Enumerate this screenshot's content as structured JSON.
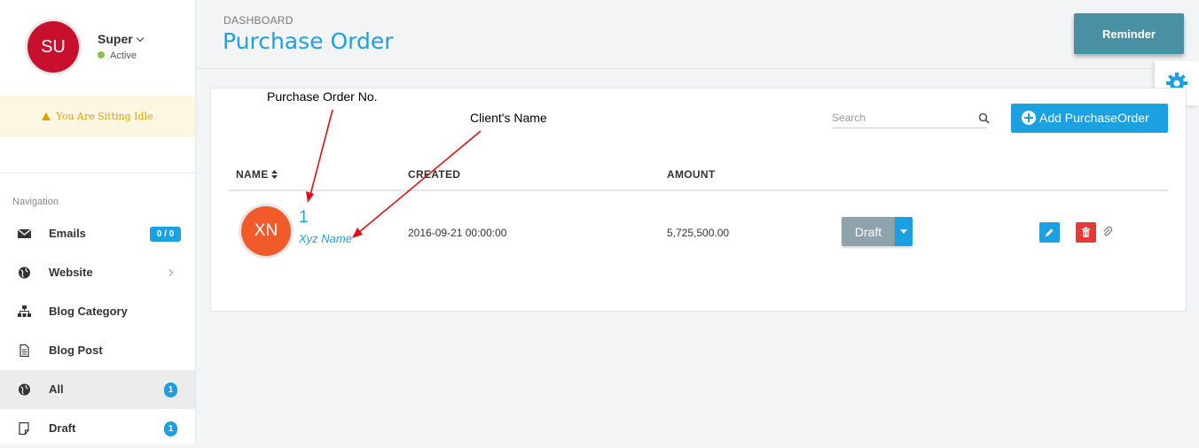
{
  "user": {
    "initials": "SU",
    "name": "Super",
    "status": "Active"
  },
  "idle_notice": "You Are Sitting Idle",
  "nav": {
    "title": "Navigation",
    "items": [
      {
        "label": "Emails",
        "badge": "0 / 0",
        "icon": "envelope-icon"
      },
      {
        "label": "Website",
        "icon": "globe-icon"
      },
      {
        "label": "Blog Category",
        "icon": "sitemap-icon"
      },
      {
        "label": "Blog Post",
        "icon": "document-icon"
      },
      {
        "label": "All",
        "badge": "1",
        "icon": "globe-icon"
      },
      {
        "label": "Draft",
        "badge": "1",
        "icon": "note-icon"
      }
    ]
  },
  "header": {
    "breadcrumb": "DASHBOARD",
    "title": "Purchase Order",
    "reminder_label": "Reminder"
  },
  "toolbar": {
    "search_placeholder": "Search",
    "add_label": "Add PurchaseOrder"
  },
  "table": {
    "columns": [
      "NAME",
      "CREATED",
      "AMOUNT"
    ],
    "rows": [
      {
        "initials": "XN",
        "po_number": "1",
        "client": "Xyz Name",
        "created": "2016-09-21 00:00:00",
        "amount": "5,725,500.00",
        "status": "Draft"
      }
    ]
  },
  "annotations": {
    "po_label": "Purchase Order No.",
    "client_label": "Client's Name"
  },
  "colors": {
    "accent": "#1ba1e2",
    "reminder": "#4a90a4",
    "danger": "#e53935",
    "avatar_user": "#c8102e",
    "avatar_row": "#f15a29",
    "idle_bg": "#fdf6e0",
    "idle_text": "#e0a100"
  }
}
